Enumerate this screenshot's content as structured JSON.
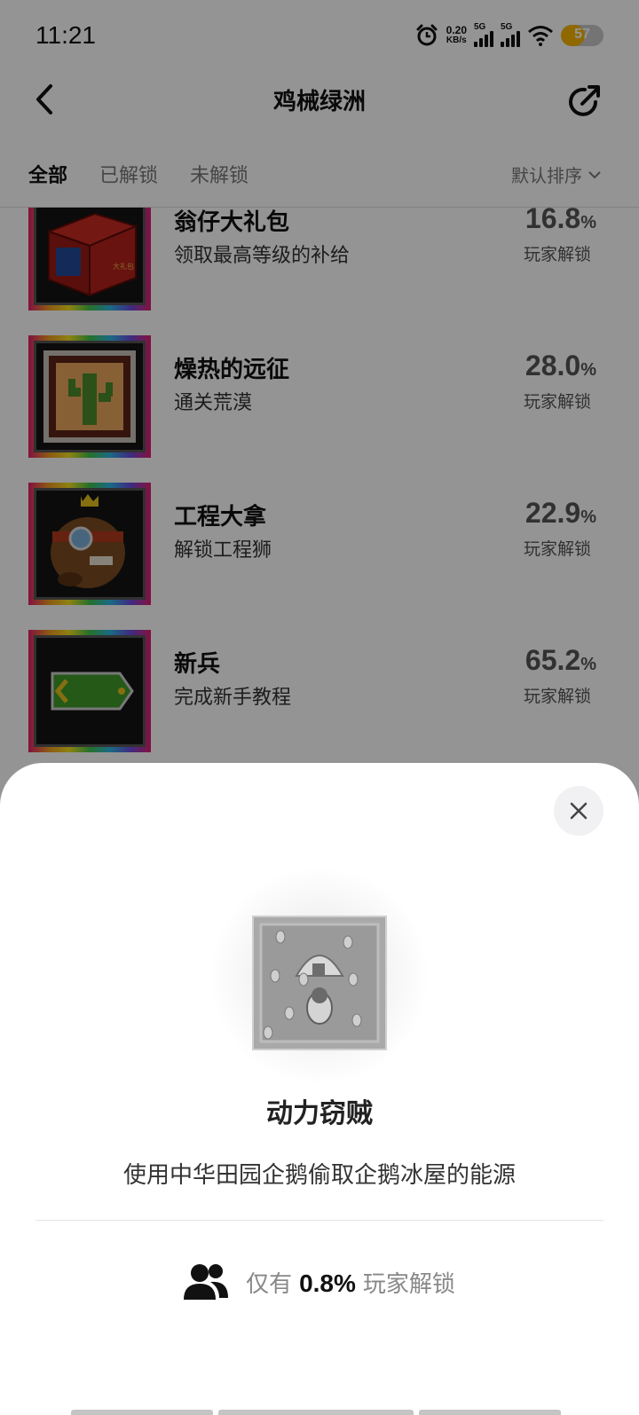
{
  "status_bar": {
    "time": "11:21",
    "net_speed": "0.20",
    "net_unit": "KB/s",
    "signal1_tag": "5G",
    "signal2_tag": "5G",
    "battery": "57",
    "battery_level": 0.57
  },
  "header": {
    "title": "鸡械绿洲",
    "back_icon": "chevron-left-icon",
    "share_icon": "share-icon"
  },
  "tabs": {
    "all": "全部",
    "unlocked": "已解锁",
    "locked": "未解锁",
    "sort": "默认排序"
  },
  "achievements": [
    {
      "name": "翁仔大礼包",
      "desc": "领取最高等级的补给",
      "pct": "16.8",
      "label": "玩家解锁",
      "icon": "gift-box-icon"
    },
    {
      "name": "燥热的远征",
      "desc": "通关荒漠",
      "pct": "28.0",
      "label": "玩家解锁",
      "icon": "cactus-icon"
    },
    {
      "name": "工程大拿",
      "desc": "解锁工程狮",
      "pct": "22.9",
      "label": "玩家解锁",
      "icon": "engineer-beaver-icon"
    },
    {
      "name": "新兵",
      "desc": "完成新手教程",
      "pct": "65.2",
      "label": "玩家解锁",
      "icon": "rank-tag-icon"
    }
  ],
  "detail": {
    "title": "动力窃贼",
    "desc": "使用中华田园企鹅偷取企鹅冰屋的能源",
    "stat_prefix": "仅有",
    "stat_value": "0.8%",
    "stat_suffix": "玩家解锁",
    "badge_icon": "igloo-penguin-icon",
    "close_icon": "close-icon",
    "users_icon": "users-icon"
  },
  "colors": {
    "overlay": "#000000",
    "text_primary": "#111111",
    "text_secondary": "#777777",
    "battery_fill": "#f6b400"
  }
}
